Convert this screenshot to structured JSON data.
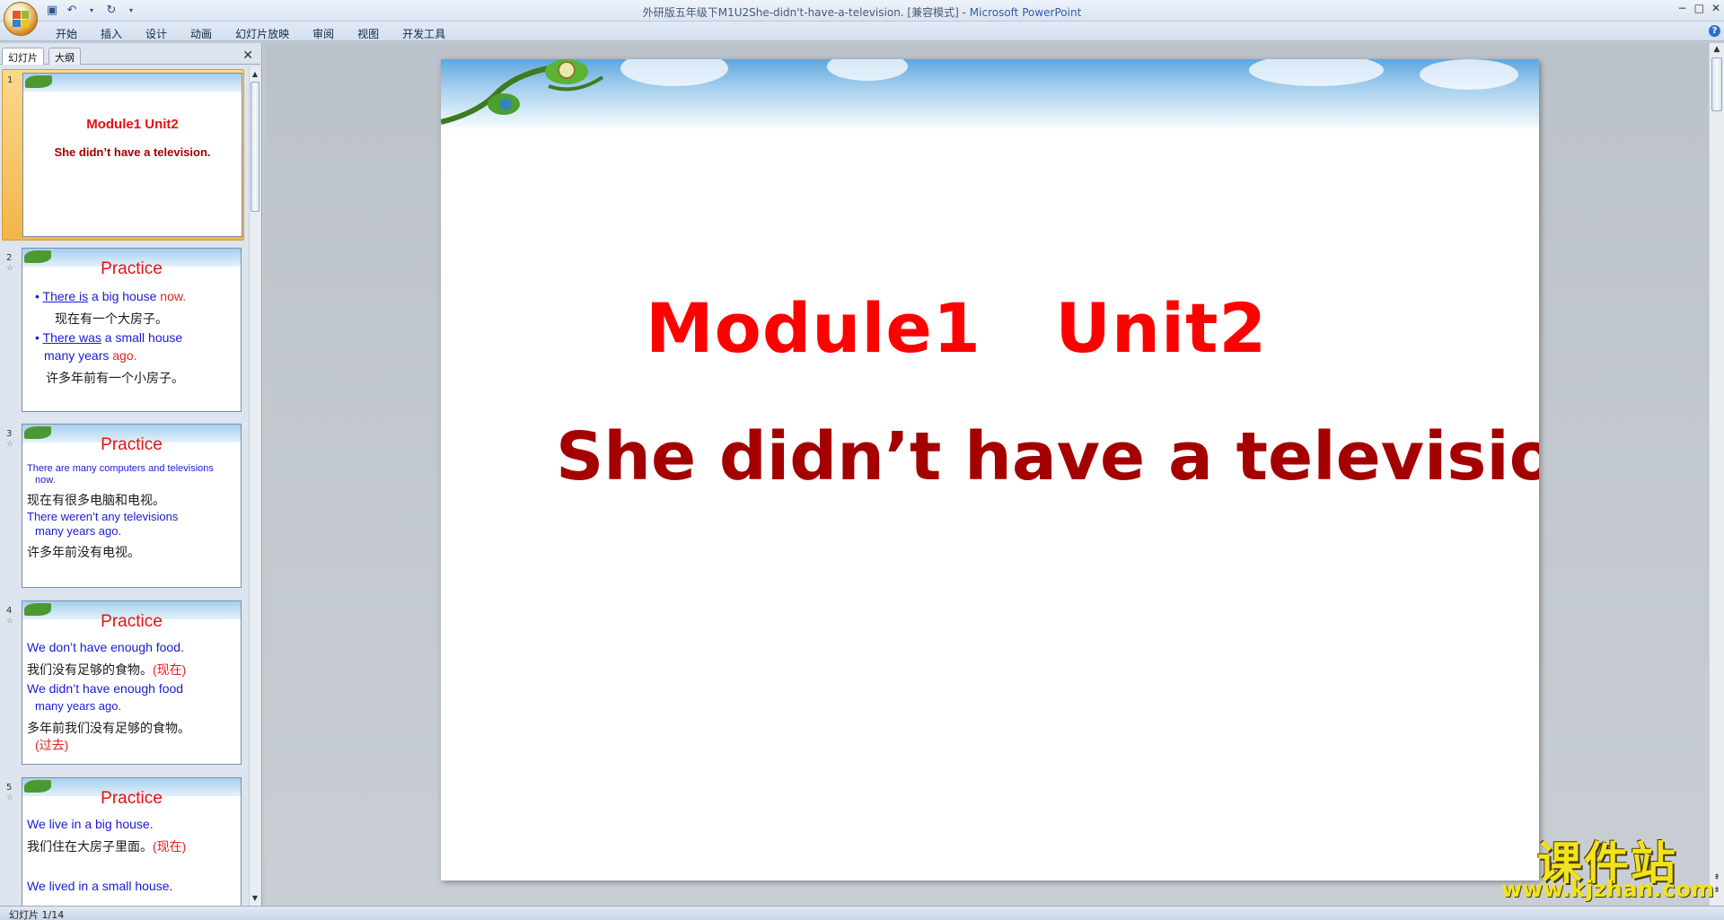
{
  "window": {
    "title": "外研版五年级下M1U2She-didn't-have-a-television. [兼容模式]",
    "app_name": "Microsoft PowerPoint",
    "controls": [
      "−",
      "□",
      "✕"
    ]
  },
  "ribbon": {
    "tabs": [
      "开始",
      "插入",
      "设计",
      "动画",
      "幻灯片放映",
      "审阅",
      "视图",
      "开发工具"
    ]
  },
  "pane": {
    "tab_slides": "幻灯片",
    "tab_outline": "大纲",
    "close": "✕"
  },
  "thumbnails": [
    {
      "num": "1",
      "title": "Module1  Unit2",
      "subtitle": "She didn’t have a television."
    },
    {
      "num": "2",
      "title": "Practice",
      "l1a": "There is",
      "l1b": " a  big house ",
      "l1c": "now.",
      "l2": "现在有一个大房子。",
      "l3a": "There was",
      "l3b": " a  small house",
      "l4a": "many years ",
      "l4b": "ago.",
      "l5": "许多年前有一个小房子。"
    },
    {
      "num": "3",
      "title": "Practice",
      "l1": "There are many computers and televisions",
      "l1b": "now.",
      "l2": "现在有很多电脑和电视。",
      "l3": "There weren’t  any televisions",
      "l4": "many years ago.",
      "l5": "许多年前没有电视。"
    },
    {
      "num": "4",
      "title": "Practice",
      "l1": "We don’t have enough food.",
      "l2a": "我们没有足够的食物。",
      "l2b": "(现在)",
      "l3": "We didn’t have enough food",
      "l4": "many years ago.",
      "l5": "多年前我们没有足够的食物。",
      "l6": "(过去)"
    },
    {
      "num": "5",
      "title": "Practice",
      "l1": "We live in a big house.",
      "l2a": "我们住在大房子里面。",
      "l2b": "(现在)",
      "l3": "We lived in a small house."
    }
  ],
  "slide": {
    "title": "Module1   Unit2",
    "subtitle": "She didn’t have a television."
  },
  "status": {
    "text": "幻灯片 1/14"
  },
  "watermark": {
    "cn": "课件站",
    "url": "www.kjzhan.com"
  },
  "colors": {
    "title_red": "#ff0000",
    "subtitle_darkred": "#a40000",
    "thumb_blue": "#1a1ad6",
    "selection_orange": "#f2b54a"
  }
}
